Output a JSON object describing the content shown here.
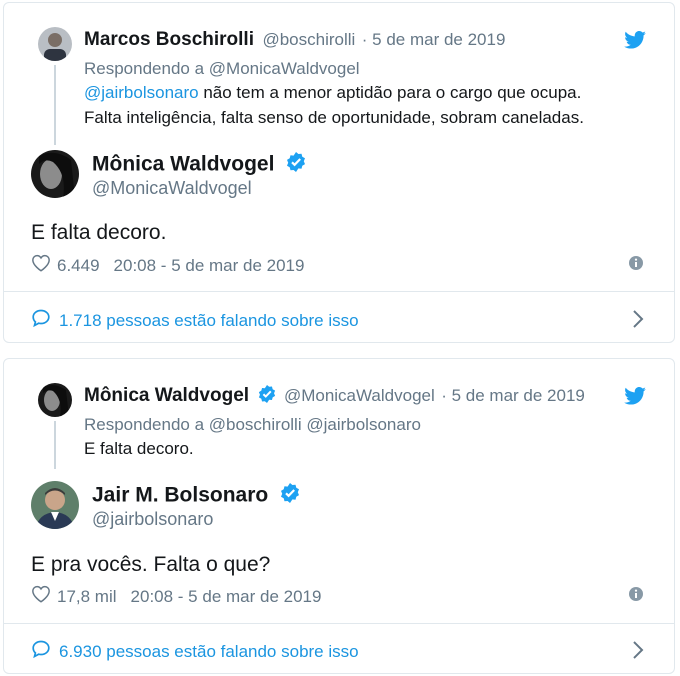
{
  "tweet1": {
    "reply": {
      "name": "Marcos Boschirolli",
      "handle": "@boschirolli",
      "date": "· 5 de mar de 2019",
      "replying_to": "Respondendo a @MonicaWaldvogel",
      "mention": "@jairbolsonaro",
      "text_line1": " não tem a menor aptidão para o cargo que ocupa.",
      "text_line2": "Falta inteligência, falta senso de oportunidade, sobram caneladas."
    },
    "main": {
      "name": "Mônica Waldvogel",
      "handle": "@MonicaWaldvogel",
      "text": "E falta decoro.",
      "likes": "6.449",
      "timestamp": "20:08 - 5 de mar de 2019"
    },
    "footer": "1.718 pessoas estão falando sobre isso"
  },
  "tweet2": {
    "reply": {
      "name": "Mônica Waldvogel",
      "handle": "@MonicaWaldvogel",
      "date": "· 5 de mar de 2019",
      "replying_to": "Respondendo a @boschirolli @jairbolsonaro",
      "text": "E falta decoro."
    },
    "main": {
      "name": "Jair M. Bolsonaro",
      "handle": "@jairbolsonaro",
      "text": "E pra vocês. Falta o que?",
      "likes": "17,8 mil",
      "timestamp": "20:08 - 5 de mar de 2019"
    },
    "footer": "6.930 pessoas estão falando sobre isso"
  },
  "colors": {
    "twitter_blue": "#1da1f2",
    "link_blue": "#1b95e0",
    "gray": "#657786",
    "border": "#e1e8ed"
  },
  "icons": [
    "twitter-bird-icon",
    "verified-badge-icon",
    "heart-icon",
    "info-icon",
    "speech-bubble-icon",
    "chevron-right-icon"
  ]
}
